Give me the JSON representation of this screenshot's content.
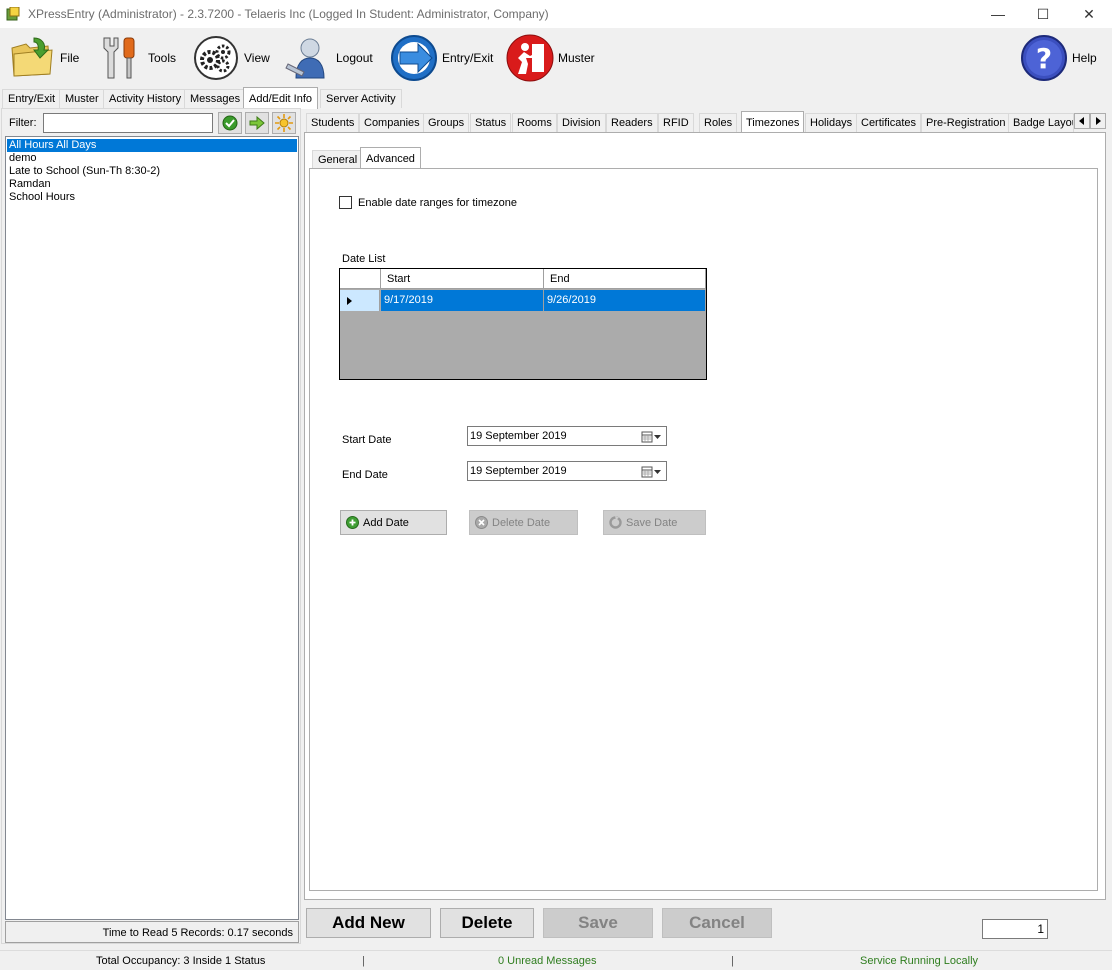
{
  "window": {
    "title": "XPressEntry (Administrator)  - 2.3.7200 - Telaeris Inc (Logged In Student: Administrator, Company)",
    "minimize": "—",
    "maximize": "☐",
    "close": "✕"
  },
  "toolbar": {
    "file": "File",
    "tools": "Tools",
    "view": "View",
    "logout": "Logout",
    "entry_exit": "Entry/Exit",
    "muster": "Muster",
    "help": "Help"
  },
  "main_tabs": [
    "Entry/Exit",
    "Muster",
    "Activity History",
    "Messages",
    "Add/Edit Info",
    "Server Activity"
  ],
  "left": {
    "filter_label": "Filter:",
    "filter_value": "",
    "items": [
      "All Hours All Days",
      "demo",
      "Late to School (Sun-Th 8:30-2)",
      "Ramdan",
      "School Hours"
    ],
    "status": "Time to Read 5 Records: 0.17 seconds"
  },
  "right_tabs": [
    "Students",
    "Companies",
    "Groups",
    "Status",
    "Rooms",
    "Division",
    "Readers",
    "RFID",
    "Roles",
    "Timezones",
    "Holidays",
    "Certificates",
    "Pre-Registration",
    "Badge Layou"
  ],
  "sub_tabs": [
    "General",
    "Advanced"
  ],
  "advanced": {
    "enable_label": "Enable date ranges for timezone",
    "enable_checked": false,
    "date_list_label": "Date List",
    "columns": [
      "Start",
      "End"
    ],
    "rows": [
      [
        "9/17/2019",
        "9/26/2019"
      ]
    ],
    "start_date_label": "Start Date",
    "start_date_value": "19 September 2019",
    "end_date_label": "End Date",
    "end_date_value": "19 September 2019",
    "add_date": "Add Date",
    "delete_date": "Delete Date",
    "save_date": "Save Date"
  },
  "bottom": {
    "add_new": "Add New",
    "delete": "Delete",
    "save": "Save",
    "cancel": "Cancel",
    "page_value": "1"
  },
  "status_bar": {
    "occupancy": "Total Occupancy: 3 Inside 1 Status",
    "messages": "0 Unread Messages",
    "service": "Service Running Locally",
    "separator": "|"
  },
  "colors": {
    "selection": "#0078d7",
    "status_green": "#2e7d1e"
  }
}
